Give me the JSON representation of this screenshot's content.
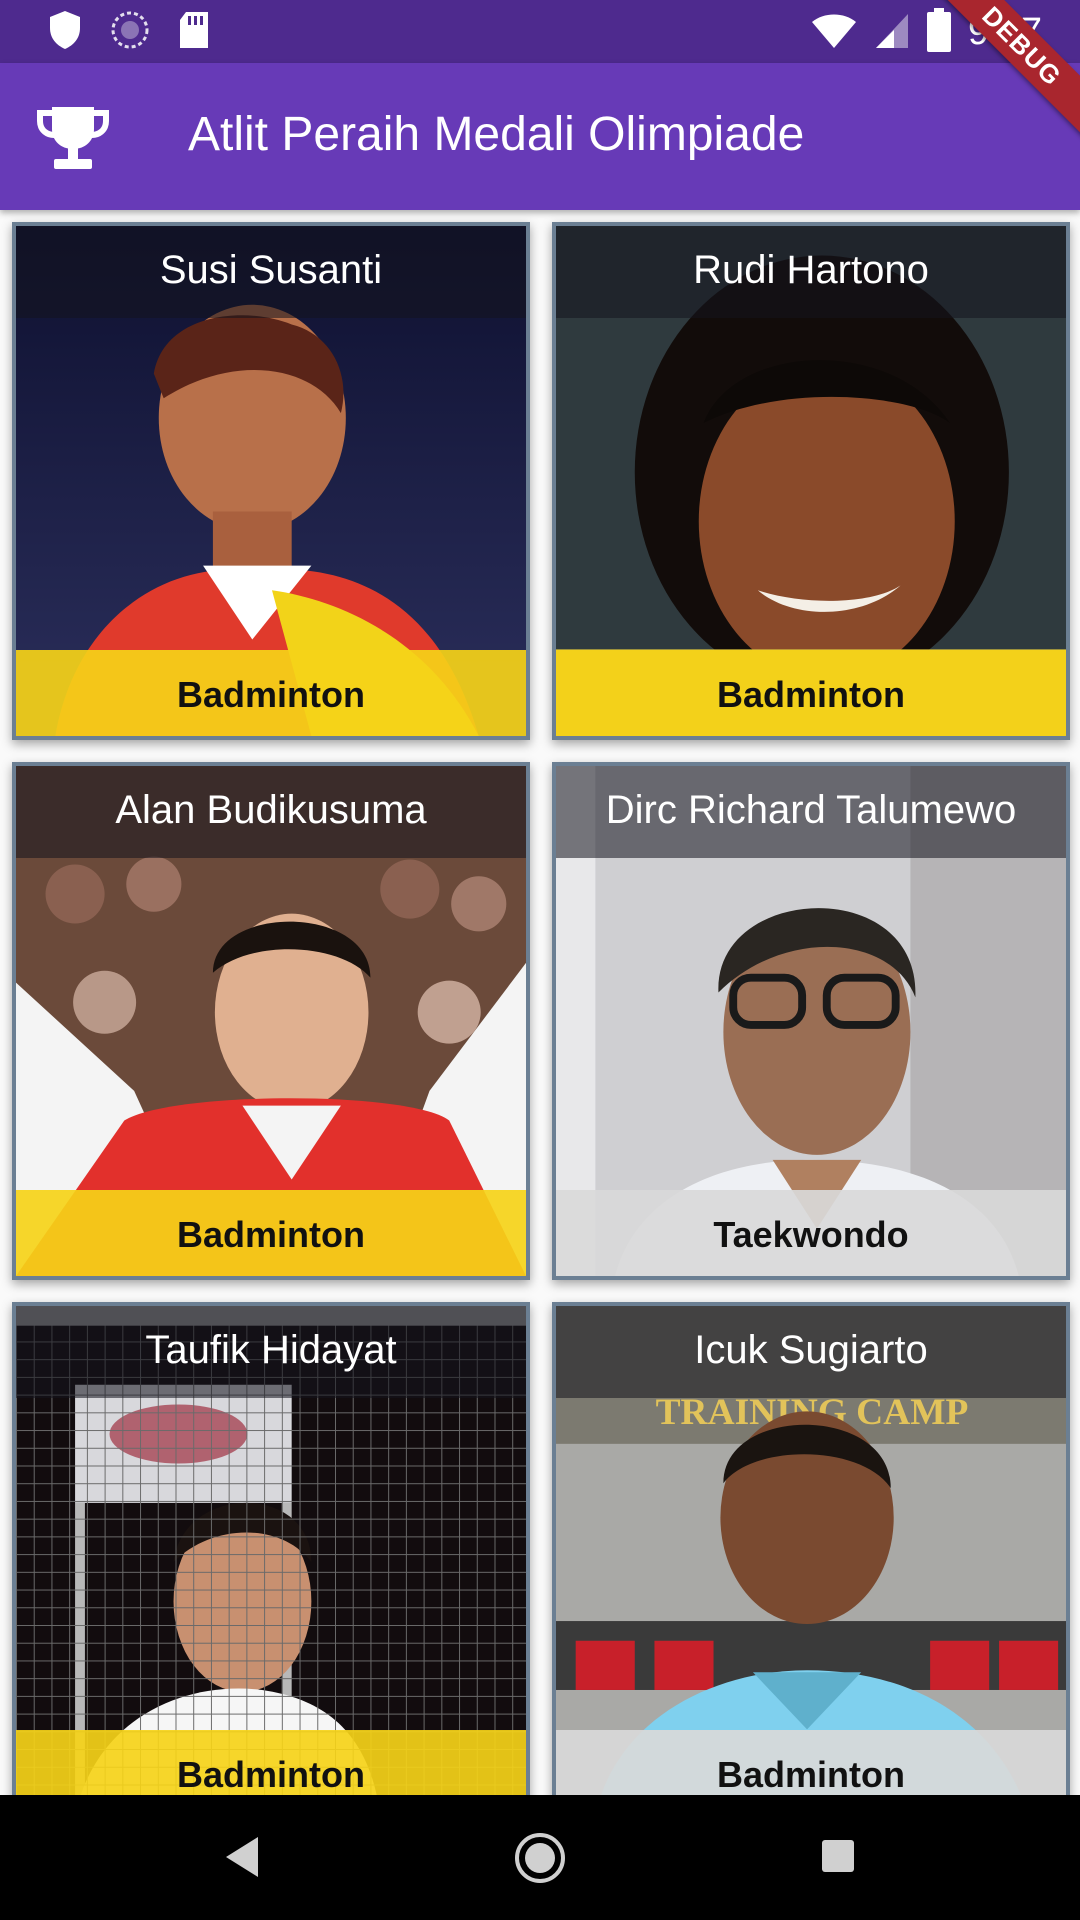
{
  "status_bar": {
    "time": "9:07",
    "icons": [
      "shield-icon",
      "sync-icon",
      "sd-card-icon",
      "wifi-icon",
      "signal-icon",
      "battery-icon"
    ]
  },
  "debug_banner": "DEBUG",
  "app_bar": {
    "title": "Atlit Peraih Medali Olimpiade",
    "icon": "trophy-icon"
  },
  "athletes": [
    {
      "name": "Susi Susanti",
      "sport": "Badminton",
      "strip_color": "#f5d218"
    },
    {
      "name": "Rudi Hartono",
      "sport": "Badminton",
      "strip_color": "#f5d218"
    },
    {
      "name": "Alan Budikusuma",
      "sport": "Badminton",
      "strip_color": "#f5d218"
    },
    {
      "name": "Dirc Richard Talumewo",
      "sport": "Taekwondo",
      "strip_color": "#d9d9d9"
    },
    {
      "name": "Taufik Hidayat",
      "sport": "Badminton",
      "strip_color": "#f5d218"
    },
    {
      "name": "Icuk Sugiarto",
      "sport": "Badminton",
      "strip_color": "#d9d9d9"
    }
  ],
  "photo_text": {
    "icuk_banner": "TRAINING CAMP"
  },
  "nav_bar": {
    "icons": [
      "back-icon",
      "home-icon",
      "recents-icon"
    ]
  }
}
